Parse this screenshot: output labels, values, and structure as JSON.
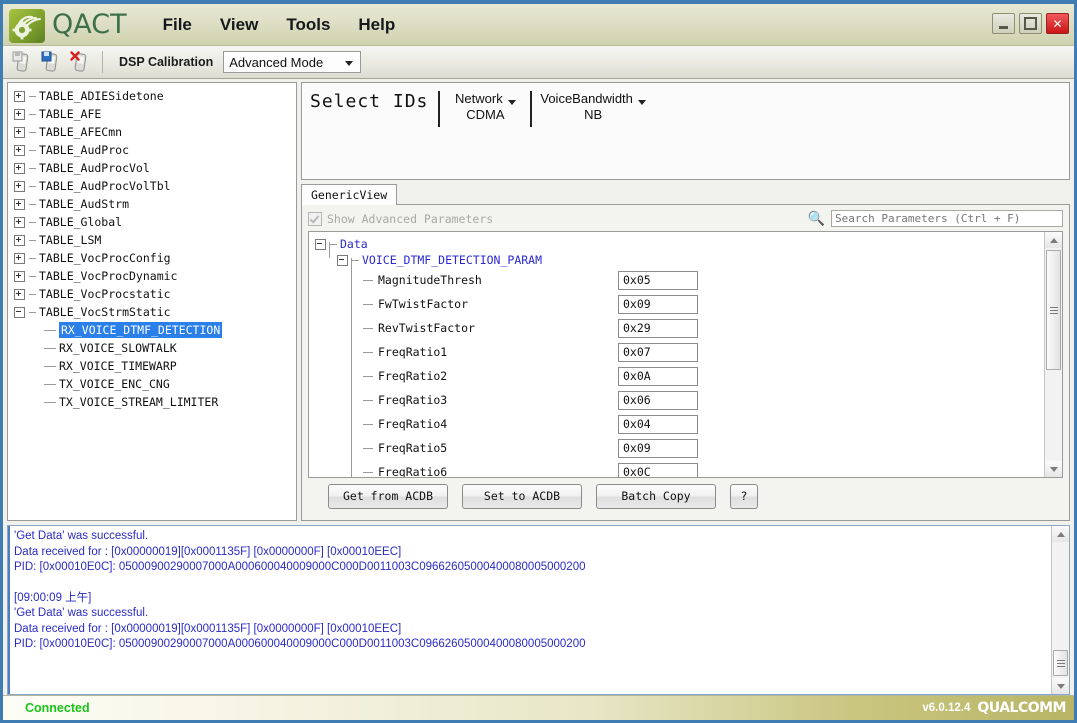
{
  "window": {
    "app_name": "QACT",
    "logo_icon": "qualcomm-gear-signal-logo",
    "menu": [
      {
        "label": "File"
      },
      {
        "label": "View"
      },
      {
        "label": "Tools"
      },
      {
        "label": "Help"
      }
    ],
    "controls": {
      "minimize": "minimize-icon",
      "maximize": "maximize-icon",
      "close": "✕"
    }
  },
  "toolbar": {
    "icons": [
      {
        "name": "save-device-icon"
      },
      {
        "name": "save-as-device-icon"
      },
      {
        "name": "close-device-icon"
      }
    ],
    "mode_label": "DSP Calibration",
    "mode_value": "Advanced Mode",
    "dropdown_icon": "chevron-down-icon"
  },
  "tree": {
    "nodes": [
      {
        "label": "TABLE_ADIESidetone",
        "expanded": false
      },
      {
        "label": "TABLE_AFE",
        "expanded": false
      },
      {
        "label": "TABLE_AFECmn",
        "expanded": false
      },
      {
        "label": "TABLE_AudProc",
        "expanded": false
      },
      {
        "label": "TABLE_AudProcVol",
        "expanded": false
      },
      {
        "label": "TABLE_AudProcVolTbl",
        "expanded": false
      },
      {
        "label": "TABLE_AudStrm",
        "expanded": false
      },
      {
        "label": "TABLE_Global",
        "expanded": false
      },
      {
        "label": "TABLE_LSM",
        "expanded": false
      },
      {
        "label": "TABLE_VocProcConfig",
        "expanded": false
      },
      {
        "label": "TABLE_VocProcDynamic",
        "expanded": false
      },
      {
        "label": "TABLE_VocProcstatic",
        "expanded": false
      },
      {
        "label": "TABLE_VocStrmStatic",
        "expanded": true
      }
    ],
    "children": [
      {
        "label": "RX_VOICE_DTMF_DETECTION",
        "selected": true
      },
      {
        "label": "RX_VOICE_SLOWTALK",
        "selected": false
      },
      {
        "label": "RX_VOICE_TIMEWARP",
        "selected": false
      },
      {
        "label": "TX_VOICE_ENC_CNG",
        "selected": false
      },
      {
        "label": "TX_VOICE_STREAM_LIMITER",
        "selected": false
      }
    ]
  },
  "select_ids": {
    "title": "Select IDs",
    "groups": [
      {
        "name": "Network",
        "value": "CDMA"
      },
      {
        "name": "VoiceBandwidth",
        "value": "NB"
      }
    ]
  },
  "tabs": [
    {
      "label": "GenericView",
      "active": true
    }
  ],
  "options": {
    "show_advanced_label": "Show Advanced Parameters",
    "show_advanced_checked": true,
    "show_advanced_disabled": true
  },
  "search": {
    "icon": "search-icon",
    "placeholder": "Search Parameters (Ctrl + F)",
    "value": ""
  },
  "param_tree": {
    "root_label": "Data",
    "group_label": "VOICE_DTMF_DETECTION_PARAM",
    "params": [
      {
        "name": "MagnitudeThresh",
        "value": "0x05"
      },
      {
        "name": "FwTwistFactor",
        "value": "0x09"
      },
      {
        "name": "RevTwistFactor",
        "value": "0x29"
      },
      {
        "name": "FreqRatio1",
        "value": "0x07"
      },
      {
        "name": "FreqRatio2",
        "value": "0x0A"
      },
      {
        "name": "FreqRatio3",
        "value": "0x06"
      },
      {
        "name": "FreqRatio4",
        "value": "0x04"
      },
      {
        "name": "FreqRatio5",
        "value": "0x09"
      },
      {
        "name": "FreqRatio6",
        "value": "0x0C"
      }
    ]
  },
  "actions": [
    {
      "label": "Get from ACDB"
    },
    {
      "label": "Set to ACDB"
    },
    {
      "label": "Batch Copy"
    },
    {
      "label": "?"
    }
  ],
  "log": {
    "lines": [
      "'Get Data' was successful.",
      "Data received for : [0x00000019][0x0001135F] [0x0000000F] [0x00010EEC]",
      "PID: [0x00010E0C]: 05000900290007000A000600040009000C000D0011003C09662605000400080005000200",
      "",
      "[09:00:09 上午]",
      "'Get Data' was successful.",
      "Data received for : [0x00000019][0x0001135F] [0x0000000F] [0x00010EEC]",
      "PID: [0x00010E0C]: 05000900290007000A000600040009000C000D0011003C09662605000400080005000200"
    ]
  },
  "status": {
    "connection": "Connected",
    "version": "v6.0.12.4",
    "brand": "QUALCOMM"
  },
  "colors": {
    "accent_blue": "#3e7cb1",
    "selection_blue": "#2a7fe8",
    "param_blue": "#2a2ad0",
    "log_blue": "#2b2bc4",
    "status_green": "#19c419",
    "title_olive": "#dedfc5"
  }
}
